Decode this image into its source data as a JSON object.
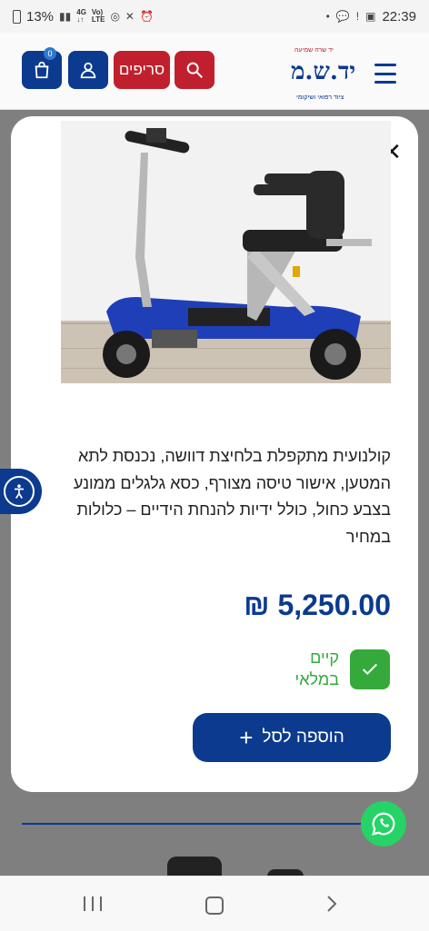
{
  "status_bar": {
    "battery": "13%",
    "time": "22:39",
    "network_lte": "LTE"
  },
  "header": {
    "cart_count": "0",
    "brands_label": "סריפים",
    "logo_text": "יד.ש.מ",
    "logo_tagline_top": "יד שרה שמיעה",
    "logo_tagline_bottom": "ציוד רפואי ושיקומי"
  },
  "modal": {
    "description": "קולנועית מתקפלת בלחיצת דוושה, נכנסת לתא המטען, אישור טיסה מצורף, כסא גלגלים ממונע בצבע כחול, כולל ידיות להנחת הידיים – כלולות במחיר",
    "price": "5,250.00 ₪",
    "stock_status_line1": "קיים",
    "stock_status_line2": "במלאי",
    "add_to_cart_label": "הוספה לסל"
  },
  "colors": {
    "brand_blue": "#0b3a8f",
    "brand_red": "#c0202e",
    "stock_green": "#35a93b",
    "whatsapp_green": "#25d366"
  }
}
